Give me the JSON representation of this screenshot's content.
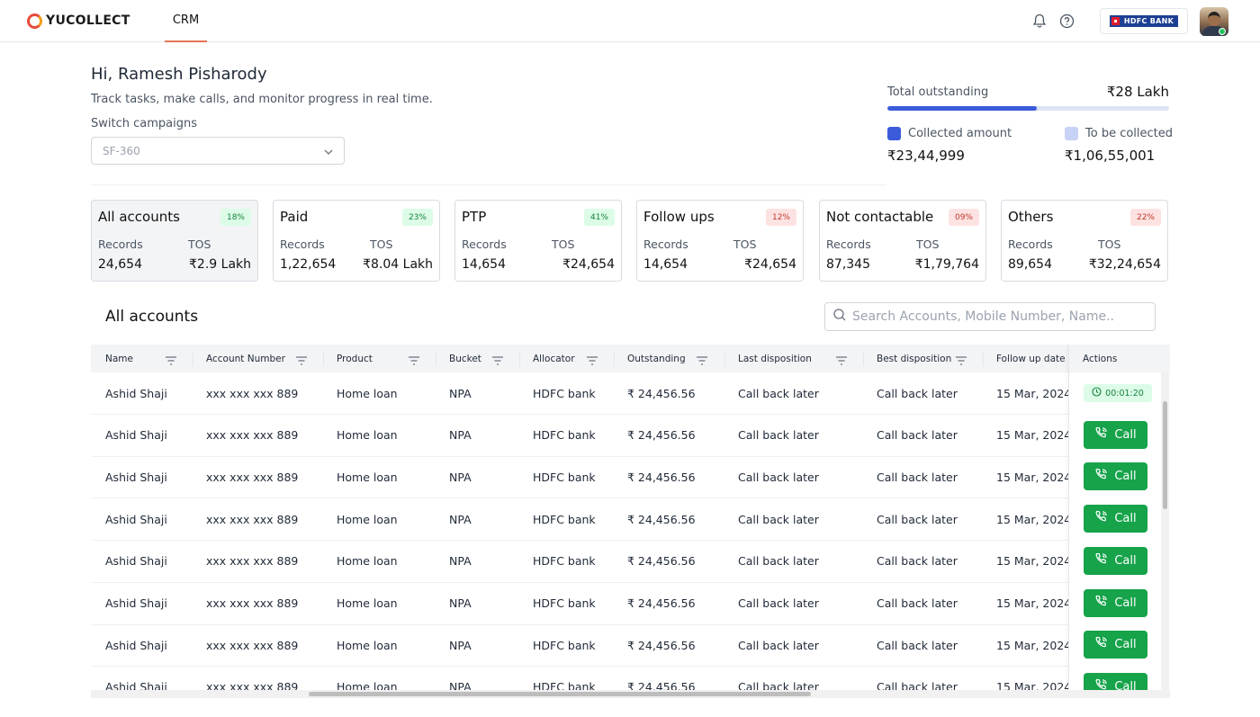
{
  "app": {
    "logo_text": "YUCOLLECT",
    "nav_tab": "CRM",
    "bank_badge": "HDFC BANK"
  },
  "greeting": {
    "title": "Hi, Ramesh Pisharody",
    "subtitle": "Track tasks, make calls, and monitor progress in real time.",
    "switch_label": "Switch campaigns",
    "campaign_selected": "SF-360"
  },
  "outstanding": {
    "label": "Total outstanding",
    "value": "₹28 Lakh",
    "collected_fraction": 0.53,
    "collected_label": "Collected amount",
    "collected_value": "₹23,44,999",
    "to_collect_label": "To be collected",
    "to_collect_value": "₹1,06,55,001",
    "colors": {
      "collected": "#3b5bdb",
      "to_collect": "#c7d2f4"
    }
  },
  "cards": [
    {
      "title": "All accounts",
      "pct": "18%",
      "pct_tone": "green",
      "records_label": "Records",
      "records": "24,654",
      "tos_label": "TOS",
      "tos": "₹2.9 Lakh"
    },
    {
      "title": "Paid",
      "pct": "23%",
      "pct_tone": "green",
      "records_label": "Records",
      "records": "1,22,654",
      "tos_label": "TOS",
      "tos": "₹8.04 Lakh"
    },
    {
      "title": "PTP",
      "pct": "41%",
      "pct_tone": "green",
      "records_label": "Records",
      "records": "14,654",
      "tos_label": "TOS",
      "tos": "₹24,654"
    },
    {
      "title": "Follow ups",
      "pct": "12%",
      "pct_tone": "red",
      "records_label": "Records",
      "records": "14,654",
      "tos_label": "TOS",
      "tos": "₹24,654"
    },
    {
      "title": "Not contactable",
      "pct": "09%",
      "pct_tone": "red",
      "records_label": "Records",
      "records": "87,345",
      "tos_label": "TOS",
      "tos": "₹1,79,764"
    },
    {
      "title": "Others",
      "pct": "22%",
      "pct_tone": "red",
      "records_label": "Records",
      "records": "89,654",
      "tos_label": "TOS",
      "tos": "₹32,24,654"
    }
  ],
  "table": {
    "title": "All accounts",
    "search_placeholder": "Search Accounts, Mobile Number, Name..",
    "columns": [
      "Name",
      "Account Number",
      "Product",
      "Bucket",
      "Allocator",
      "Outstanding",
      "Last disposition",
      "Best disposition",
      "Follow up date"
    ],
    "actions_header": "Actions",
    "timer_value": "00:01:20",
    "call_label": "Call",
    "rows": [
      {
        "name": "Ashid Shaji",
        "account": "xxx xxx xxx 889",
        "product": "Home loan",
        "bucket": "NPA",
        "allocator": "HDFC bank",
        "outstanding": "₹ 24,456.56",
        "last": "Call back later",
        "best": "Call back later",
        "followup": "15 Mar, 2024"
      },
      {
        "name": "Ashid Shaji",
        "account": "xxx xxx xxx 889",
        "product": "Home loan",
        "bucket": "NPA",
        "allocator": "HDFC bank",
        "outstanding": "₹ 24,456.56",
        "last": "Call back later",
        "best": "Call back later",
        "followup": "15 Mar, 2024"
      },
      {
        "name": "Ashid Shaji",
        "account": "xxx xxx xxx 889",
        "product": "Home loan",
        "bucket": "NPA",
        "allocator": "HDFC bank",
        "outstanding": "₹ 24,456.56",
        "last": "Call back later",
        "best": "Call back later",
        "followup": "15 Mar, 2024"
      },
      {
        "name": "Ashid Shaji",
        "account": "xxx xxx xxx 889",
        "product": "Home loan",
        "bucket": "NPA",
        "allocator": "HDFC bank",
        "outstanding": "₹ 24,456.56",
        "last": "Call back later",
        "best": "Call back later",
        "followup": "15 Mar, 2024"
      },
      {
        "name": "Ashid Shaji",
        "account": "xxx xxx xxx 889",
        "product": "Home loan",
        "bucket": "NPA",
        "allocator": "HDFC bank",
        "outstanding": "₹ 24,456.56",
        "last": "Call back later",
        "best": "Call back later",
        "followup": "15 Mar, 2024"
      },
      {
        "name": "Ashid Shaji",
        "account": "xxx xxx xxx 889",
        "product": "Home loan",
        "bucket": "NPA",
        "allocator": "HDFC bank",
        "outstanding": "₹ 24,456.56",
        "last": "Call back later",
        "best": "Call back later",
        "followup": "15 Mar, 2024"
      },
      {
        "name": "Ashid Shaji",
        "account": "xxx xxx xxx 889",
        "product": "Home loan",
        "bucket": "NPA",
        "allocator": "HDFC bank",
        "outstanding": "₹ 24,456.56",
        "last": "Call back later",
        "best": "Call back later",
        "followup": "15 Mar, 2024"
      },
      {
        "name": "Ashid Shaji",
        "account": "xxx xxx xxx 889",
        "product": "Home loan",
        "bucket": "NPA",
        "allocator": "HDFC bank",
        "outstanding": "₹ 24,456.56",
        "last": "Call back later",
        "best": "Call back later",
        "followup": "15 Mar, 2024"
      }
    ]
  }
}
